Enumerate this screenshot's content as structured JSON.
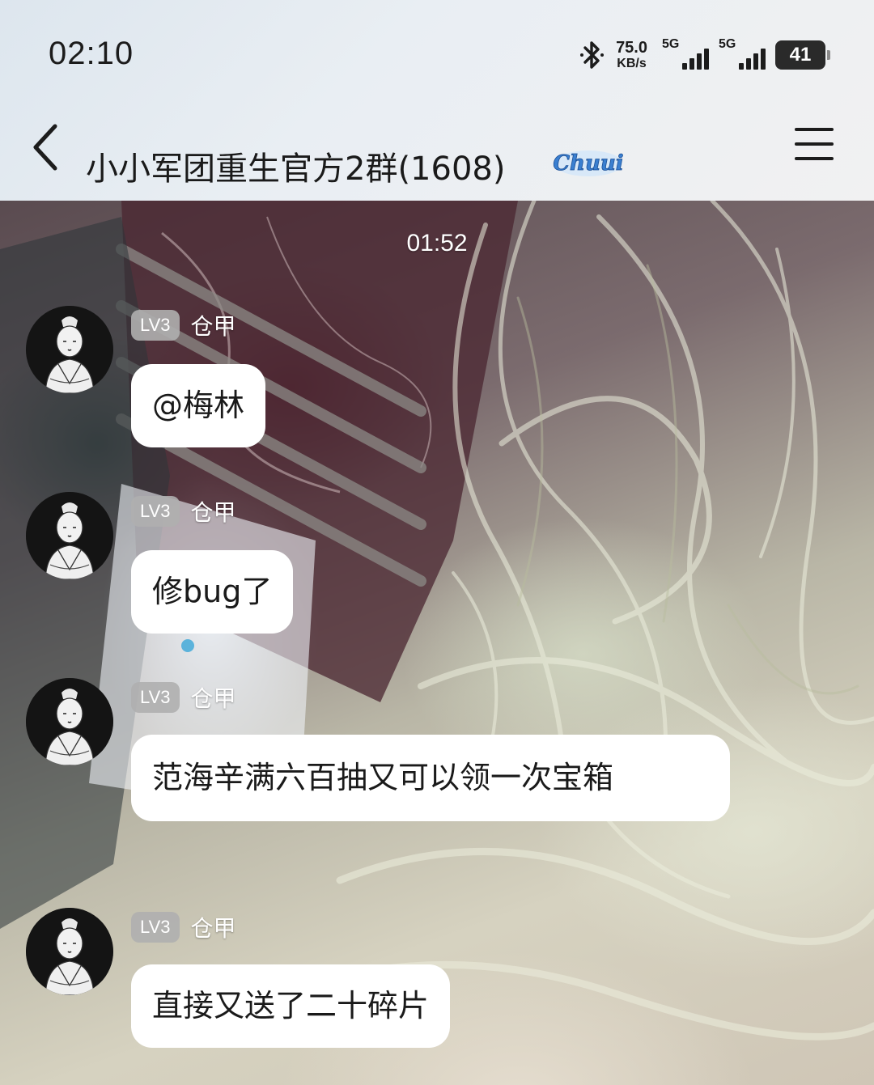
{
  "status_bar": {
    "time": "02:10",
    "net_speed_value": "75.0",
    "net_speed_unit": "KB/s",
    "sim1_label": "5G",
    "sim2_label": "5G",
    "battery_level": "41",
    "icons": [
      "bluetooth-icon",
      "signal-icon",
      "battery-icon"
    ]
  },
  "header": {
    "title": "小小军团重生官方2群(1608)",
    "badge_text": "Chuui",
    "icons": [
      "back-icon",
      "menu-icon"
    ]
  },
  "chat": {
    "time_separator": "01:52",
    "messages": [
      {
        "level": "LV3",
        "sender": "仓甲",
        "text": "@梅林"
      },
      {
        "level": "LV3",
        "sender": "仓甲",
        "text": "修bug了"
      },
      {
        "level": "LV3",
        "sender": "仓甲",
        "text": "范海辛满六百抽又可以领一次宝箱"
      },
      {
        "level": "LV3",
        "sender": "仓甲",
        "text": "直接又送了二十碎片"
      }
    ]
  },
  "colors": {
    "bubble": "#ffffff",
    "level_badge": "#afafaf",
    "text_dark": "#1a1a1a",
    "badge_accent": "#4a8fd8"
  }
}
